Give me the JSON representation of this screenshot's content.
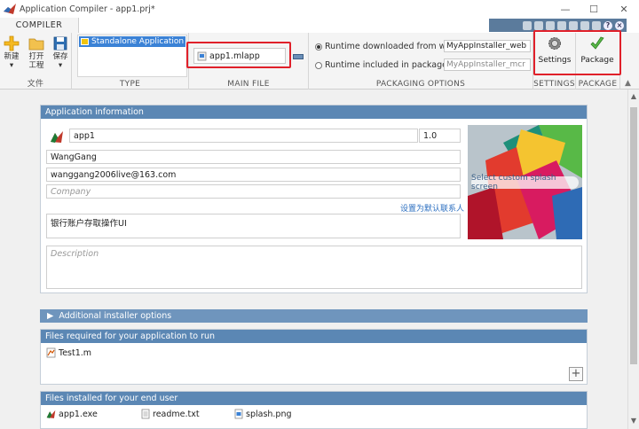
{
  "window": {
    "title": "Application Compiler - app1.prj*"
  },
  "toolstrip": {
    "tab": "COMPILER",
    "file_section": {
      "label": "文件",
      "new_label": "新建",
      "open_label": "打开\n工程",
      "save_label": "保存"
    },
    "type_section": {
      "label": "TYPE",
      "selected_type": "Standalone Application"
    },
    "main_file_section": {
      "label": "MAIN FILE",
      "file": "app1.mlapp"
    },
    "packaging_section": {
      "label": "PACKAGING OPTIONS",
      "option_web": "Runtime downloaded from web",
      "web_installer_name": "MyAppInstaller_web",
      "option_package": "Runtime included in package",
      "mcr_installer_name": "MyAppInstaller_mcr",
      "selected": "web"
    },
    "settings_section": {
      "label": "SETTINGS",
      "button": "Settings"
    },
    "package_section": {
      "label": "PACKAGE",
      "button": "Package"
    }
  },
  "app_info": {
    "header": "Application information",
    "app_name": "app1",
    "version": "1.0",
    "author": "WangGang",
    "email": "wanggang2006live@163.com",
    "company_placeholder": "Company",
    "set_default_contact": "设置为默认联系人",
    "summary": "银行账户存取操作UI",
    "description_placeholder": "Description",
    "splash_button": "Select custom splash screen"
  },
  "additional_options": {
    "header": "Additional installer options"
  },
  "files_required": {
    "header": "Files required for your application to run",
    "files": [
      "Test1.m"
    ]
  },
  "files_installed": {
    "header": "Files installed for your end user",
    "files": [
      "app1.exe",
      "readme.txt",
      "splash.png"
    ]
  },
  "colors": {
    "panel_header": "#5b87b4",
    "highlight": "#e0202a",
    "selection": "#3b82d6"
  }
}
